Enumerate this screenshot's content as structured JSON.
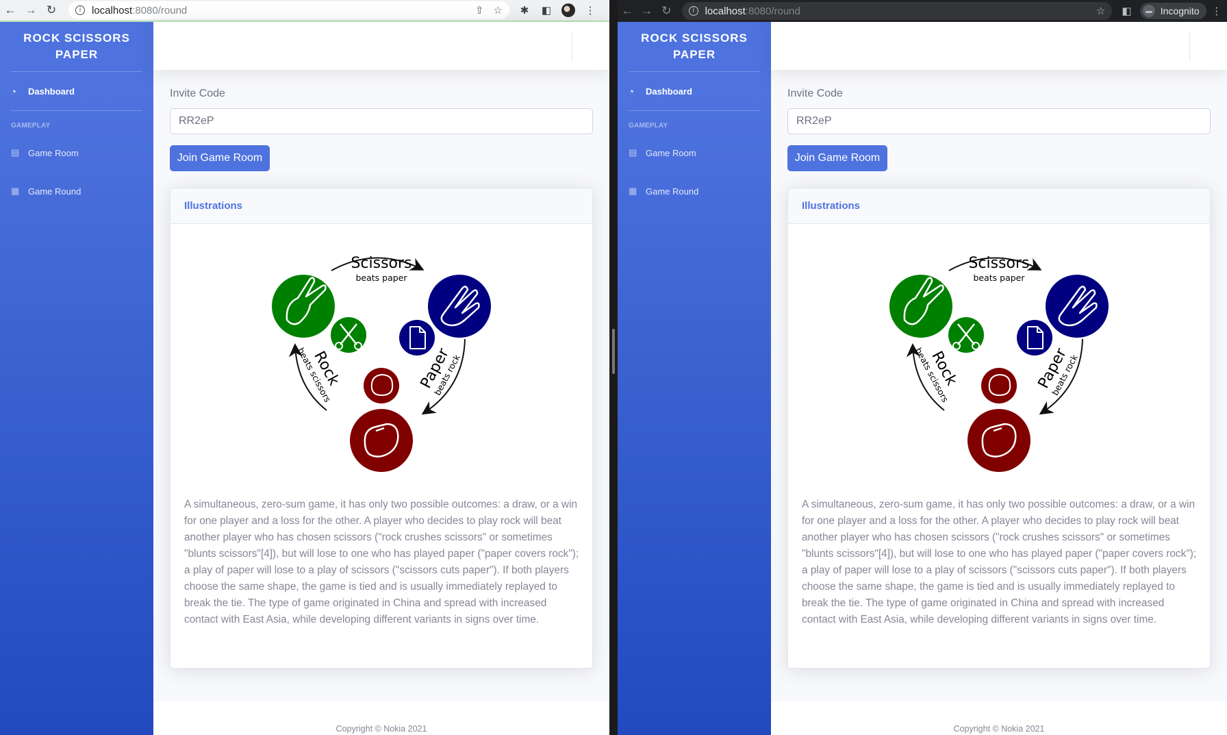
{
  "windows": [
    {
      "id": "normal",
      "url": {
        "host": "localhost",
        "path": ":8080/round"
      },
      "incognito": false
    },
    {
      "id": "incognito",
      "url": {
        "host": "localhost",
        "path": ":8080/round"
      },
      "incognito": true,
      "incognito_label": "Incognito"
    }
  ],
  "app": {
    "brand": "ROCK SCISSORS PAPER",
    "nav": {
      "dashboard": "Dashboard",
      "heading": "GAMEPLAY",
      "game_room": "Game Room",
      "game_round": "Game Round"
    },
    "form": {
      "label": "Invite Code",
      "value": "RR2eP",
      "button": "Join Game Room"
    },
    "card": {
      "title": "Illustrations",
      "diagram": {
        "scissors": {
          "title": "Scissors",
          "subtitle": "beats paper"
        },
        "rock": {
          "title": "Rock",
          "subtitle": "beats scissors"
        },
        "paper": {
          "title": "Paper",
          "subtitle": "beats rock"
        }
      },
      "text": "A simultaneous, zero-sum game, it has only two possible outcomes: a draw, or a win for one player and a loss for the other. A player who decides to play rock will beat another player who has chosen scissors (\"rock crushes scissors\" or sometimes \"blunts scissors\"[4]), but will lose to one who has played paper (\"paper covers rock\"); a play of paper will lose to a play of scissors (\"scissors cuts paper\"). If both players choose the same shape, the game is tied and is usually immediately replayed to break the tie. The type of game originated in China and spread with increased contact with East Asia, while developing different variants in signs over time."
    },
    "footer": "Copyright © Nokia 2021"
  },
  "colors": {
    "primary": "#4e73df",
    "sidebar_bottom": "#224abe",
    "scissors": "#008000",
    "paper": "#000080",
    "rock": "#800000"
  },
  "icons": [
    "back-arrow-icon",
    "forward-arrow-icon",
    "reload-icon",
    "info-icon",
    "share-icon",
    "star-icon",
    "extensions-icon",
    "side-panel-icon",
    "menu-icon",
    "dashboard-icon",
    "chart-icon",
    "table-icon"
  ]
}
